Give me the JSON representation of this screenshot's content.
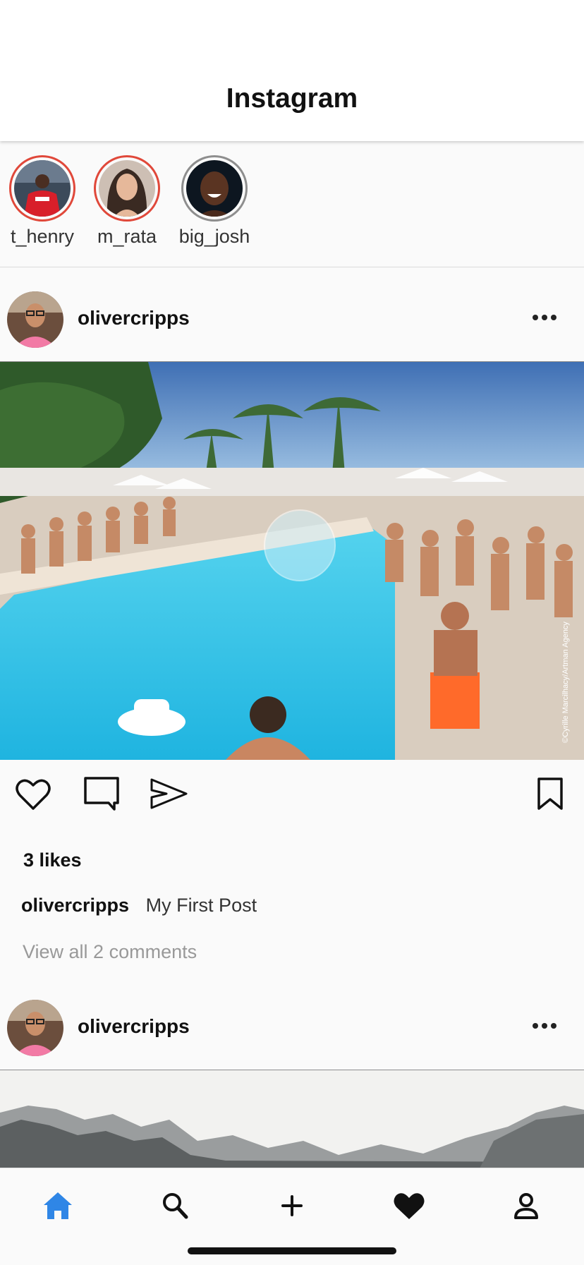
{
  "header": {
    "title": "Instagram"
  },
  "stories": [
    {
      "username": "t_henry",
      "seen": false
    },
    {
      "username": "m_rata",
      "seen": false
    },
    {
      "username": "big_josh",
      "seen": true
    }
  ],
  "posts": [
    {
      "username": "olivercripps",
      "likes": "3 likes",
      "caption_user": "olivercripps",
      "caption": "My First Post",
      "view_comments": "View all 2 comments",
      "watermark": "©Cyrille Marcilhacy/Artman Agency"
    },
    {
      "username": "olivercripps"
    }
  ],
  "tabbar": {
    "items": [
      "home-icon",
      "search-icon",
      "add-icon",
      "heart-icon",
      "profile-icon"
    ],
    "active": "home-icon",
    "active_color": "#2f86e6"
  }
}
